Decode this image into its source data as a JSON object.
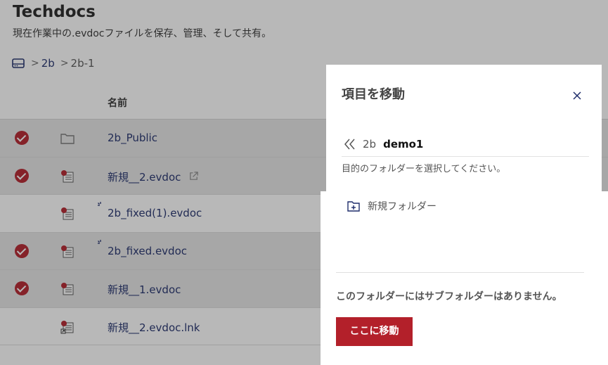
{
  "app": {
    "title": "Techdocs",
    "subtitle": "現在作業中の.evdocファイルを保存、管理、そして共有。"
  },
  "breadcrumb": {
    "icon": "drive-icon",
    "items": [
      "2b",
      "2b-1"
    ]
  },
  "table": {
    "headers": {
      "name": "名前"
    },
    "rows": [
      {
        "name": "2b_Public",
        "type": "folder",
        "selected": true
      },
      {
        "name": "新規__2.evdoc",
        "type": "evdoc",
        "selected": true,
        "external_link": true
      },
      {
        "name": "2b_fixed(1).evdoc",
        "type": "evdoc",
        "selected": false,
        "loading": true
      },
      {
        "name": "2b_fixed.evdoc",
        "type": "evdoc",
        "selected": true,
        "loading": true
      },
      {
        "name": "新規__1.evdoc",
        "type": "evdoc",
        "selected": true
      },
      {
        "name": "新規__2.evdoc.lnk",
        "type": "evdoc-link",
        "selected": false
      }
    ]
  },
  "dialog": {
    "title": "項目を移動",
    "path_parent": "2b",
    "path_current": "demo1",
    "hint": "目的のフォルダーを選択してください。",
    "new_folder_label": "新規フォルダー",
    "empty_message": "このフォルダーにはサブフォルダーはありません。",
    "move_button": "ここに移動"
  },
  "colors": {
    "accent": "#b3202a",
    "link": "#1f2d6b",
    "overlay": "rgba(40,40,40,0.33)"
  }
}
